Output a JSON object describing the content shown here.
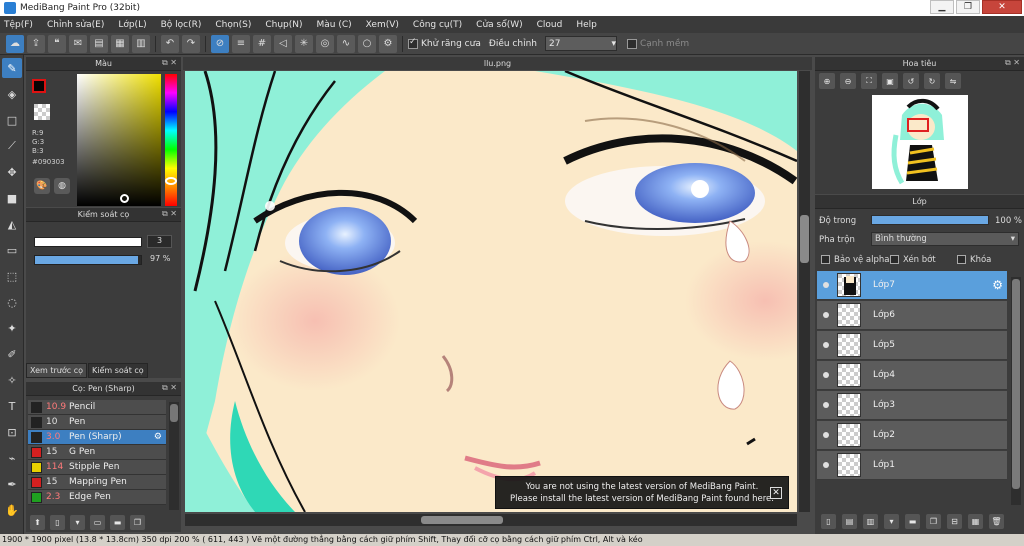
{
  "window": {
    "title": "MediBang Paint Pro (32bit)",
    "minimize_icon": "minimize-icon",
    "maximize_icon": "maximize-icon",
    "close_icon": "close-icon"
  },
  "menu": [
    "Tệp(F)",
    "Chỉnh sửa(E)",
    "Lớp(L)",
    "Bộ lọc(R)",
    "Chọn(S)",
    "Chụp(N)",
    "Màu (C)",
    "Xem(V)",
    "Công cụ(T)",
    "Cửa sổ(W)",
    "Cloud",
    "Help"
  ],
  "toolbar": {
    "antialias_label": "Khử răng cưa",
    "adjust_label": "Điều chỉnh",
    "adjust_value": "27",
    "edge_label": "Cạnh mềm"
  },
  "color_panel": {
    "title": "Màu",
    "r": "R:9",
    "g": "G:3",
    "b": "B:3",
    "hex": "#090303",
    "fg_color": "#090303"
  },
  "brush_control": {
    "title": "Kiểm soát cọ",
    "size_value": "3",
    "opacity_value": "97 %",
    "opacity_fraction": 0.97,
    "tab_preview": "Xem trước cọ",
    "tab_control": "Kiểm soát cọ"
  },
  "brush_list": {
    "title": "Cọ: Pen (Sharp)",
    "items": [
      {
        "size": "10.9",
        "name": "Pencil",
        "color": "#222222",
        "size_color": "#ff7a7a"
      },
      {
        "size": "10",
        "name": "Pen",
        "color": "#222222",
        "size_color": "#e0e0e0"
      },
      {
        "size": "3.0",
        "name": "Pen (Sharp)",
        "color": "#222222",
        "size_color": "#ff7a7a"
      },
      {
        "size": "15",
        "name": "G Pen",
        "color": "#d42020",
        "size_color": "#e0e0e0"
      },
      {
        "size": "114",
        "name": "Stipple Pen",
        "color": "#e8d000",
        "size_color": "#ff7a7a"
      },
      {
        "size": "15",
        "name": "Mapping Pen",
        "color": "#d42020",
        "size_color": "#e0e0e0"
      },
      {
        "size": "2.3",
        "name": "Edge Pen",
        "color": "#1fa020",
        "size_color": "#ff7a7a"
      }
    ]
  },
  "canvas": {
    "doc_title": "llu.png"
  },
  "toast": {
    "line1": "You are not using the latest version of MediBang Paint.",
    "line2": "Please install the latest version of MediBang Paint found here."
  },
  "navigator": {
    "title": "Hoa tiêu"
  },
  "layers": {
    "title": "Lớp",
    "opacity_label": "Độ trong",
    "opacity_value": "100 %",
    "opacity_fraction": 1.0,
    "blend_label": "Pha trộn",
    "blend_value": "Bình thường",
    "protect_alpha": "Bảo vệ alpha",
    "clipping": "Xén bớt",
    "lock": "Khóa",
    "items": [
      "Lớp7",
      "Lớp6",
      "Lớp5",
      "Lớp4",
      "Lớp3",
      "Lớp2",
      "Lớp1"
    ]
  },
  "status": {
    "text": "1900 * 1900 pixel   (13.8 * 13.8cm)   350 dpi   200 %   ( 611, 443 )   Vẽ một đường thẳng bằng cách giữ phím Shift, Thay đổi cỡ cọ bằng cách giữ phím Ctrl, Alt và kéo"
  },
  "colors": {
    "accent": "#3d7fc1",
    "hair": "#8ff0d8",
    "skin": "#fbe9c9",
    "iris": "#6f8fe0"
  }
}
